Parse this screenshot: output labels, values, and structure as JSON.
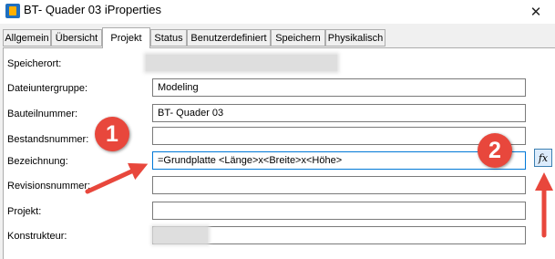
{
  "window": {
    "title": "BT- Quader 03 iProperties",
    "close_glyph": "✕"
  },
  "tabs": [
    "Allgemein",
    "Übersicht",
    "Projekt",
    "Status",
    "Benutzerdefiniert",
    "Speichern",
    "Physikalisch"
  ],
  "active_tab": "Projekt",
  "fields": {
    "speicherort": {
      "label": "Speicherort:",
      "value": ""
    },
    "dateiuntergruppe": {
      "label": "Dateiuntergruppe:",
      "value": "Modeling"
    },
    "bauteilnummer": {
      "label": "Bauteilnummer:",
      "value": "BT- Quader 03"
    },
    "bestandsnummer": {
      "label": "Bestandsnummer:",
      "value": ""
    },
    "bezeichnung": {
      "label": "Bezeichnung:",
      "value": "=Grundplatte <Länge>x<Breite>x<Höhe>"
    },
    "revisionsnummer": {
      "label": "Revisionsnummer:",
      "value": ""
    },
    "projekt": {
      "label": "Projekt:",
      "value": ""
    },
    "konstrukteur": {
      "label": "Konstrukteur:",
      "value": ""
    }
  },
  "fx_button": {
    "icon": "function-fx-icon",
    "glyph": "fx"
  },
  "annotations": {
    "badge1": "1",
    "badge2": "2",
    "accent_color": "#e8473c"
  }
}
